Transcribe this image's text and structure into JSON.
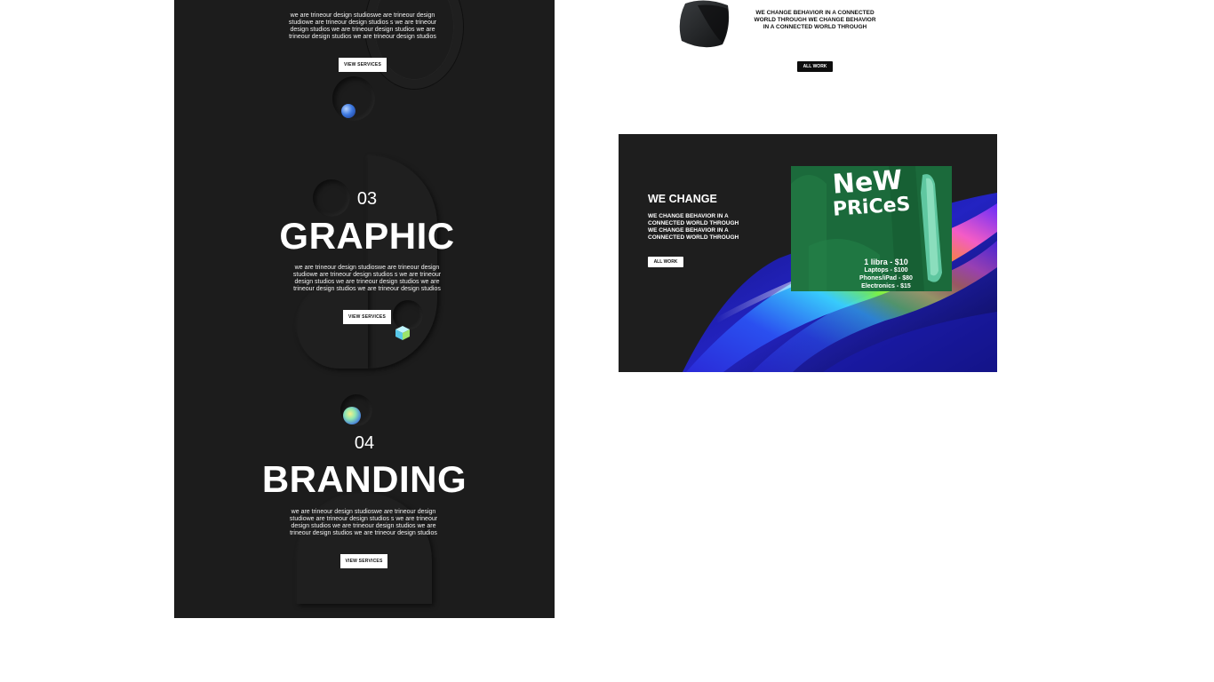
{
  "panel": {
    "intro_paragraph": "we are trineour design studioswe are trineour design studiowe are trineour design studios s we are trineour design studios we are trineour design studios we are trineour design studios we are trineour design studios",
    "intro_button": "VIEW SERVICES",
    "sections": [
      {
        "number": "03",
        "title": "GRAPHIC",
        "paragraph": "we are trineour design studioswe are trineour design studiowe are trineour design studios s we are trineour design studios we are trineour design studios we are trineour design studios we are trineour design studios",
        "button": "VIEW SERVICES"
      },
      {
        "number": "04",
        "title": "BRANDING",
        "paragraph": "we are trineour design studioswe are trineour design studiowe are trineour design studios s we are trineour design studios we are trineour design studios we are trineour design studios we are trineour design studios",
        "button": "VIEW SERVICES"
      }
    ]
  },
  "right": {
    "top_text": "WE CHANGE BEHAVIOR IN A CONNECTED WORLD THROUGH WE CHANGE BEHAVIOR IN A CONNECTED WORLD THROUGH",
    "top_button": "ALL WORK",
    "card": {
      "title": "WE CHANGE",
      "text": "WE CHANGE BEHAVIOR IN A CONNECTED WORLD THROUGH WE CHANGE BEHAVIOR IN A CONNECTED WORLD THROUGH",
      "button": "ALL WORK",
      "poster": {
        "title_line1": "NeW",
        "title_line2": "PRiCeS",
        "prices": [
          "1 libra - $10",
          "Laptops - $100",
          "Phones/iPad - $80",
          "Electronics - $15"
        ]
      }
    }
  },
  "colors": {
    "panel_bg": "#1c1c1c",
    "card_bg": "#1e1e1e",
    "poster_green": "#1d6e3f",
    "accent_blue": "#2a56c7"
  }
}
